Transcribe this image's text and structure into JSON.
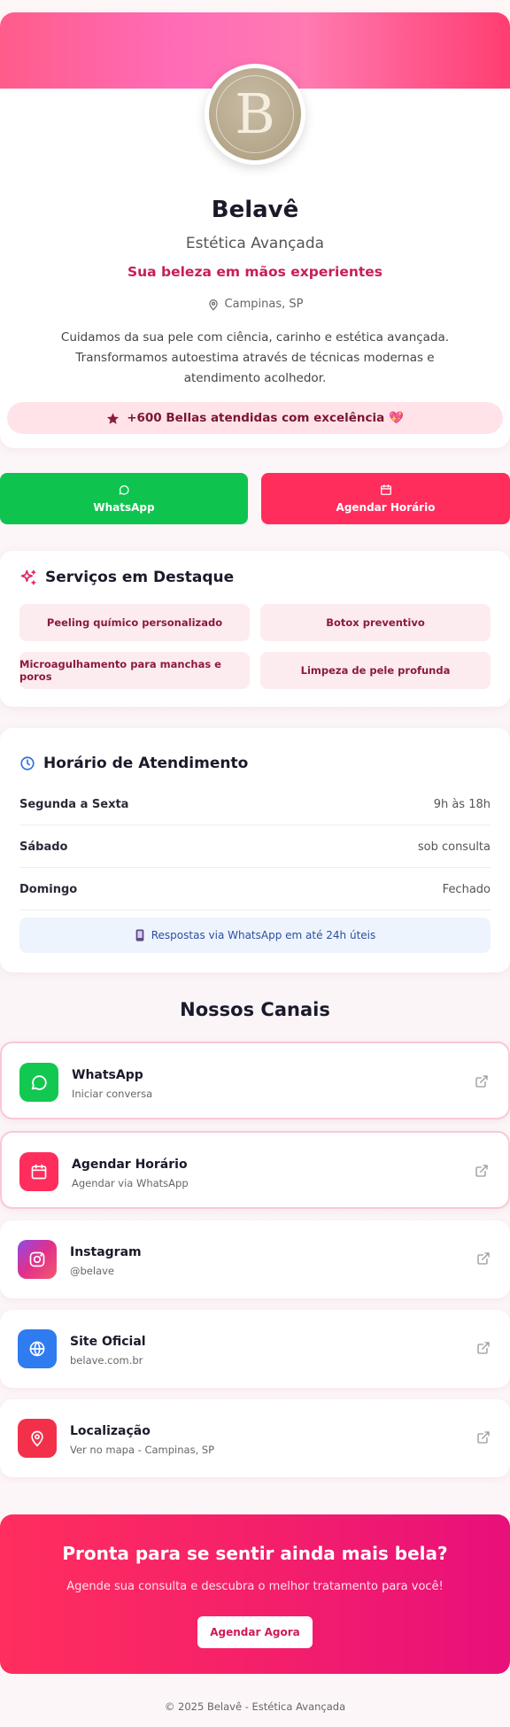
{
  "profile": {
    "logo_letter": "B",
    "name": "Belavê",
    "subtitle": "Estética Avançada",
    "tagline": "Sua beleza em mãos experientes",
    "location": "Campinas, SP",
    "description": "Cuidamos da sua pele com ciência, carinho e estética avançada. Transformamos autoestima através de técnicas modernas e atendimento acolhedor.",
    "badge": "+600 Bellas atendidas com excelência 💖"
  },
  "cta": {
    "whatsapp": "WhatsApp",
    "schedule": "Agendar Horário"
  },
  "services": {
    "title": "Serviços em Destaque",
    "items": [
      "Peeling químico personalizado",
      "Botox preventivo",
      "Microagulhamento para manchas e poros",
      "Limpeza de pele profunda"
    ]
  },
  "hours": {
    "title": "Horário de Atendimento",
    "rows": [
      {
        "day": "Segunda a Sexta",
        "time": "9h às 18h"
      },
      {
        "day": "Sábado",
        "time": "sob consulta"
      },
      {
        "day": "Domingo",
        "time": "Fechado"
      }
    ],
    "note": "Respostas via WhatsApp em até 24h úteis"
  },
  "channels": {
    "title": "Nossos Canais",
    "items": [
      {
        "name": "WhatsApp",
        "sub": "Iniciar conversa",
        "icon": "whatsapp-icon",
        "color": "#12c851"
      },
      {
        "name": "Agendar Horário",
        "sub": "Agendar via WhatsApp",
        "icon": "calendar-icon",
        "color": "#ff2d5c"
      },
      {
        "name": "Instagram",
        "sub": "@belave",
        "icon": "instagram-icon",
        "color": "#c13ad6"
      },
      {
        "name": "Site Oficial",
        "sub": "belave.com.br",
        "icon": "globe-icon",
        "color": "#2f7bf0"
      },
      {
        "name": "Localização",
        "sub": "Ver no mapa - Campinas, SP",
        "icon": "map-pin-icon",
        "color": "#f2304a"
      }
    ]
  },
  "footer_cta": {
    "title": "Pronta para se sentir ainda mais bela?",
    "subtitle": "Agende sua consulta e descubra o melhor tratamento para você!",
    "button": "Agendar Agora"
  },
  "copyright": "© 2025 Belavê - Estética Avançada",
  "colors": {
    "accent": "#ff2d5c",
    "whatsapp": "#0ec44f",
    "tagline": "#c81e5a"
  }
}
